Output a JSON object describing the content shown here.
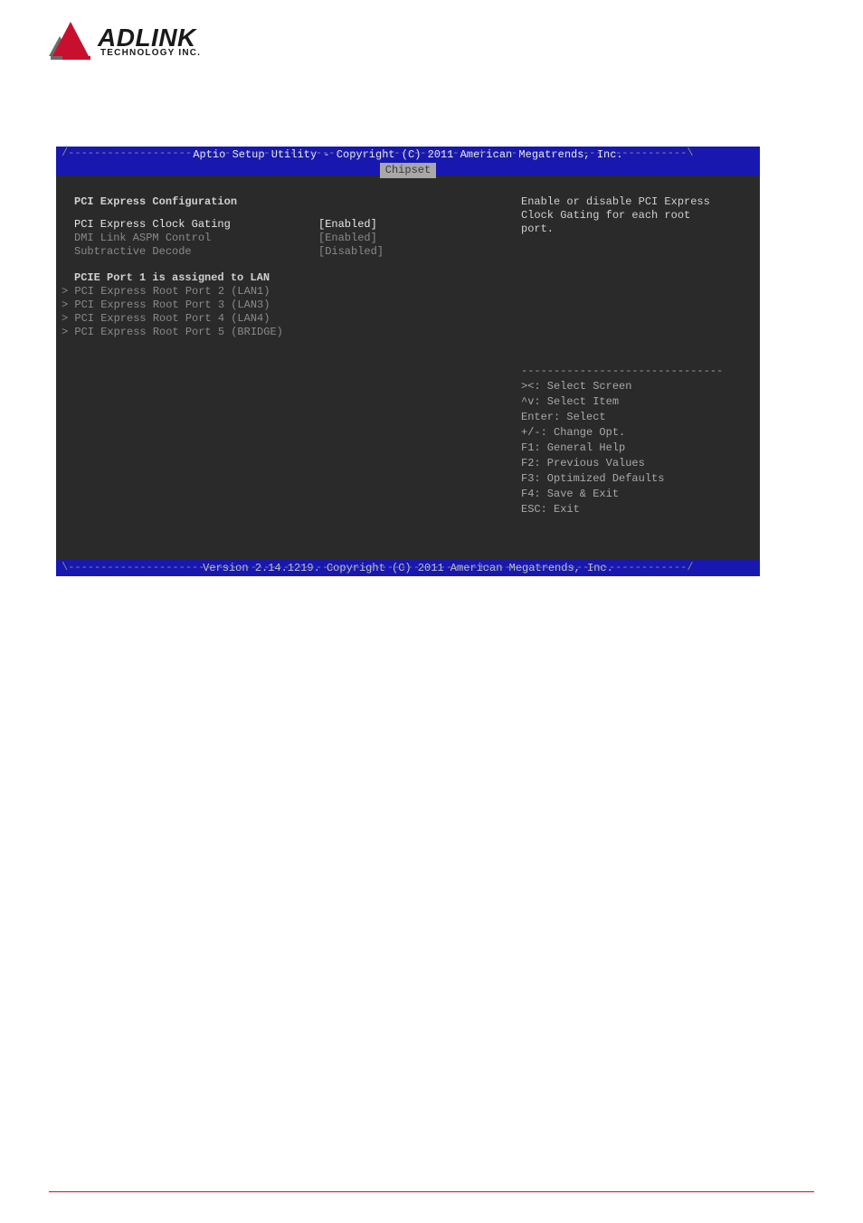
{
  "logo": {
    "main": "ADLINK",
    "sub": "TECHNOLOGY INC."
  },
  "bios": {
    "title": "Aptio Setup Utility - Copyright (C) 2011 American Megatrends, Inc.",
    "tab": "Chipset",
    "section_title": "PCI Express Configuration",
    "settings": [
      {
        "label": "PCI Express Clock Gating",
        "value": "[Enabled]",
        "selected": true
      },
      {
        "label": "DMI Link ASPM Control",
        "value": "[Enabled]",
        "selected": false
      },
      {
        "label": "Subtractive Decode",
        "value": "[Disabled]",
        "selected": false
      }
    ],
    "assigned_note": "PCIE Port 1 is assigned to LAN",
    "submenus": [
      "> PCI Express Root Port 2 (LAN1)",
      "> PCI Express Root Port 3 (LAN3)",
      "> PCI Express Root Port 4 (LAN4)",
      "> PCI Express Root Port 5 (BRIDGE)"
    ],
    "help_text": "Enable or disable PCI Express\nClock Gating for each root\nport.",
    "keyhelp": [
      "><: Select Screen",
      "^v: Select Item",
      "Enter: Select",
      "+/-: Change Opt.",
      "F1: General Help",
      "F2: Previous Values",
      "F3: Optimized Defaults",
      "F4: Save & Exit",
      "ESC: Exit"
    ],
    "footer": "Version 2.14.1219. Copyright (C) 2011 American Megatrends, Inc."
  }
}
